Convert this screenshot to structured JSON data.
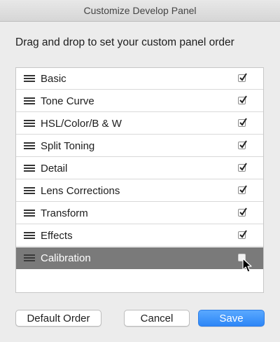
{
  "window": {
    "title": "Customize Develop Panel"
  },
  "instructions": "Drag and drop to set your custom panel order",
  "panels": [
    {
      "label": "Basic",
      "checked": true
    },
    {
      "label": "Tone Curve",
      "checked": true
    },
    {
      "label": "HSL/Color/B & W",
      "checked": true
    },
    {
      "label": "Split Toning",
      "checked": true
    },
    {
      "label": "Detail",
      "checked": true
    },
    {
      "label": "Lens Corrections",
      "checked": true
    },
    {
      "label": "Transform",
      "checked": true
    },
    {
      "label": "Effects",
      "checked": true
    },
    {
      "label": "Calibration",
      "checked": false,
      "state": "dragging"
    }
  ],
  "buttons": {
    "default_order": "Default Order",
    "cancel": "Cancel",
    "save": "Save"
  },
  "colors": {
    "accent": "#2d86f7",
    "drag_row": "#7a7a7a",
    "window_bg": "#ececec"
  }
}
